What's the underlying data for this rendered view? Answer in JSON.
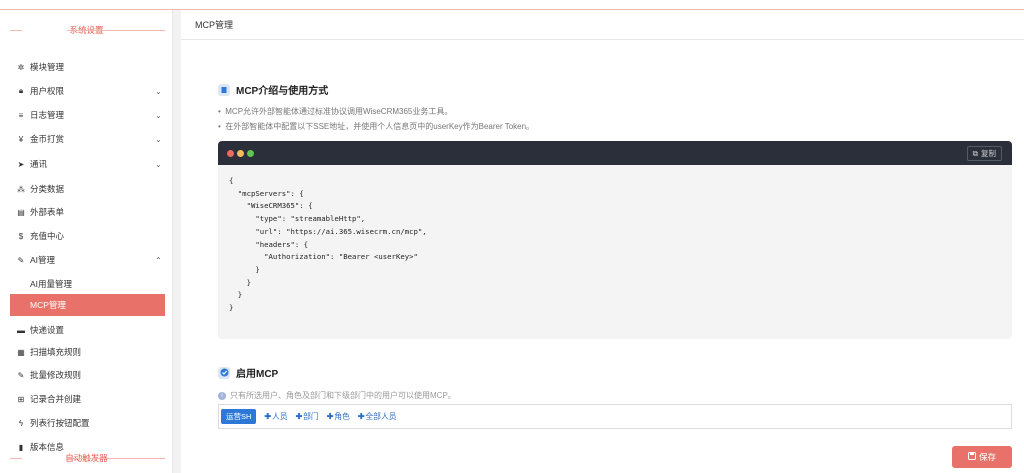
{
  "sidebar": {
    "section_system": "系统设置",
    "section_auto": "自动触发器",
    "items": [
      {
        "icon": "gear-icon",
        "glyph": "✲",
        "label": "模块管理",
        "chevron": ""
      },
      {
        "icon": "lock-icon",
        "glyph": "🔒︎",
        "label": "用户权限",
        "chevron": "⌄"
      },
      {
        "icon": "list-icon",
        "glyph": "≡",
        "label": "日志管理",
        "chevron": "⌄"
      },
      {
        "icon": "yen-icon",
        "glyph": "¥",
        "label": "金币打赏",
        "chevron": "⌄"
      },
      {
        "icon": "send-icon",
        "glyph": "➤",
        "label": "通讯",
        "chevron": "⌄"
      },
      {
        "icon": "sitemap-icon",
        "glyph": "⁂",
        "label": "分类数据",
        "chevron": ""
      },
      {
        "icon": "form-icon",
        "glyph": "▤",
        "label": "外部表单",
        "chevron": ""
      },
      {
        "icon": "dollar-icon",
        "glyph": "$",
        "label": "充值中心",
        "chevron": ""
      },
      {
        "icon": "magic-wand-icon",
        "glyph": "✎",
        "label": "AI管理",
        "chevron": "⌃"
      },
      {
        "icon": "",
        "glyph": "",
        "label": "AI用量管理",
        "chevron": ""
      },
      {
        "icon": "",
        "glyph": "",
        "label": "MCP管理",
        "chevron": ""
      },
      {
        "icon": "truck-icon",
        "glyph": "▬",
        "label": "快递设置",
        "chevron": ""
      },
      {
        "icon": "grid-icon",
        "glyph": "▦",
        "label": "扫描填充规则",
        "chevron": ""
      },
      {
        "icon": "edit-icon",
        "glyph": "✎",
        "label": "批量修改规则",
        "chevron": ""
      },
      {
        "icon": "plus-square-icon",
        "glyph": "⊞",
        "label": "记录合并创建",
        "chevron": ""
      },
      {
        "icon": "bolt-icon",
        "glyph": "ϟ",
        "label": "列表行按钮配置",
        "chevron": ""
      },
      {
        "icon": "book-icon",
        "glyph": "▮",
        "label": "版本信息",
        "chevron": ""
      }
    ]
  },
  "main": {
    "header_title": "MCP管理",
    "intro": {
      "title": "MCP介绍与使用方式",
      "bullets": [
        "MCP允许外部智能体通过标准协议调用WiseCRM365业务工具。",
        "在外部智能体中配置以下SSE地址，并使用个人信息页中的userKey作为Bearer Token。"
      ],
      "copy_label": "复制",
      "code": "{\n  \"mcpServers\": {\n    \"WiseCRM365\": {\n      \"type\": \"streamableHttp\",\n      \"url\": \"https://ai.365.wisecrm.cn/mcp\",\n      \"headers\": {\n        \"Authorization\": \"Bearer <userKey>\"\n      }\n    }\n  }\n}"
    },
    "enable": {
      "title": "启用MCP",
      "hint": "只有所选用户、角色及部门和下级部门中的用户可以使用MCP。",
      "chip": "运营SH",
      "add_links": [
        "人员",
        "部门",
        "角色",
        "全部人员"
      ]
    },
    "save_label": "保存"
  },
  "colors": {
    "accent": "#e8716a",
    "primary": "#2e78d8",
    "code_bar": "#2b2f3a",
    "dot_red": "#ec6a5e",
    "dot_yellow": "#f4bf4f",
    "dot_green": "#61c554"
  }
}
